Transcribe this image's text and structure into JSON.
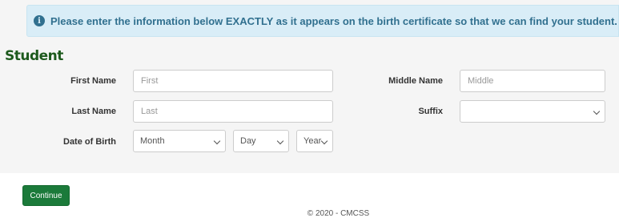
{
  "alert": {
    "icon": "info-circle-icon",
    "text": "Please enter the information below EXACTLY as it appears on the birth certificate so that we can find your student."
  },
  "section": {
    "title": "Student"
  },
  "fields": {
    "first_name": {
      "label": "First Name",
      "placeholder": "First"
    },
    "middle_name": {
      "label": "Middle Name",
      "placeholder": "Middle"
    },
    "last_name": {
      "label": "Last Name",
      "placeholder": "Last"
    },
    "suffix": {
      "label": "Suffix",
      "value": ""
    },
    "dob": {
      "label": "Date of Birth",
      "month": "Month",
      "day": "Day",
      "year": "Year"
    }
  },
  "actions": {
    "continue_label": "Continue"
  },
  "footer": {
    "text": "© 2020 - CMCSS"
  },
  "colors": {
    "alert_bg": "#d9edf7",
    "alert_text": "#31708f",
    "section_title": "#1d5a1d",
    "button": "#1b7a3a"
  }
}
